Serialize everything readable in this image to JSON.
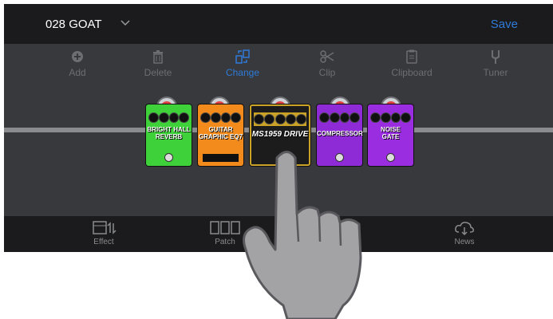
{
  "header": {
    "patch_name": "028 GOAT",
    "save_label": "Save"
  },
  "toolbar": {
    "items": [
      {
        "label": "Add",
        "icon": "add-circle-icon",
        "active": false
      },
      {
        "label": "Delete",
        "icon": "trash-icon",
        "active": false
      },
      {
        "label": "Change",
        "icon": "change-icon",
        "active": true
      },
      {
        "label": "Clip",
        "icon": "scissors-icon",
        "active": false
      },
      {
        "label": "Clipboard",
        "icon": "clipboard-icon",
        "active": false
      },
      {
        "label": "Tuner",
        "icon": "tuner-fork-icon",
        "active": false
      }
    ]
  },
  "chain": {
    "pedals": [
      {
        "name": "BRIGHT HALL REVERB",
        "color": "#3fd13a"
      },
      {
        "name": "GUITAR GRAPHIC EQ7",
        "color": "#f28a1c"
      },
      {
        "name": "MS1959 DRIVE",
        "color": "#1c1c1c"
      },
      {
        "name": "COMPRESSOR",
        "color": "#8f2bd6"
      },
      {
        "name": "NOISE GATE",
        "color": "#9a2de0"
      }
    ]
  },
  "bottom_nav": {
    "items": [
      {
        "label": "Effect",
        "icon": "effect-icon"
      },
      {
        "label": "Patch",
        "icon": "patch-icon"
      },
      {
        "label": "News",
        "icon": "cloud-download-icon"
      }
    ]
  },
  "colors": {
    "accent": "#2f7bd9",
    "background": "#38393c",
    "bars": "#1b1b1d"
  }
}
